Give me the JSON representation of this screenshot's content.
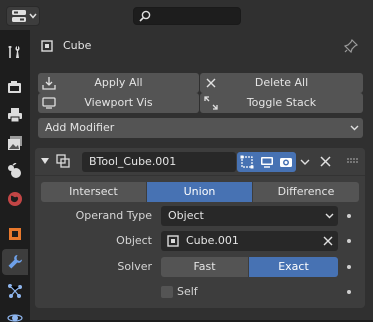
{
  "header": {
    "editor_type_icon": "properties-editor-icon",
    "search_placeholder": ""
  },
  "sidebar": {
    "tabs": [
      {
        "name": "tool-tab",
        "icon": "wrench-screwdriver-icon"
      },
      {
        "name": "render-tab",
        "icon": "camera-back-icon"
      },
      {
        "name": "output-tab",
        "icon": "printer-icon"
      },
      {
        "name": "view-layer-tab",
        "icon": "image-stack-icon"
      },
      {
        "name": "scene-tab",
        "icon": "scene-icon"
      },
      {
        "name": "world-tab",
        "icon": "world-icon"
      },
      {
        "name": "object-tab",
        "icon": "object-square-icon"
      },
      {
        "name": "modifiers-tab",
        "icon": "wrench-icon",
        "active": true
      },
      {
        "name": "particles-tab",
        "icon": "particles-icon"
      },
      {
        "name": "physics-tab",
        "icon": "physics-icon"
      }
    ]
  },
  "object": {
    "name": "Cube",
    "pin_icon": "pin-icon"
  },
  "toolbar": {
    "apply_all": "Apply All",
    "delete_all": "Delete All",
    "viewport_vis": "Viewport Vis",
    "toggle_stack": "Toggle Stack",
    "add_modifier": "Add Modifier"
  },
  "modifier": {
    "name": "BTool_Cube.001",
    "operations": [
      "Intersect",
      "Union",
      "Difference"
    ],
    "active_operation": "Union",
    "operand_type_label": "Operand Type",
    "operand_type_value": "Object",
    "object_label": "Object",
    "object_value": "Cube.001",
    "solver_label": "Solver",
    "solver_options": [
      "Fast",
      "Exact"
    ],
    "active_solver": "Exact",
    "self_label": "Self",
    "self_checked": false
  },
  "colors": {
    "accent": "#4772b3",
    "panel": "#303030",
    "button": "#545454",
    "field": "#282828"
  }
}
